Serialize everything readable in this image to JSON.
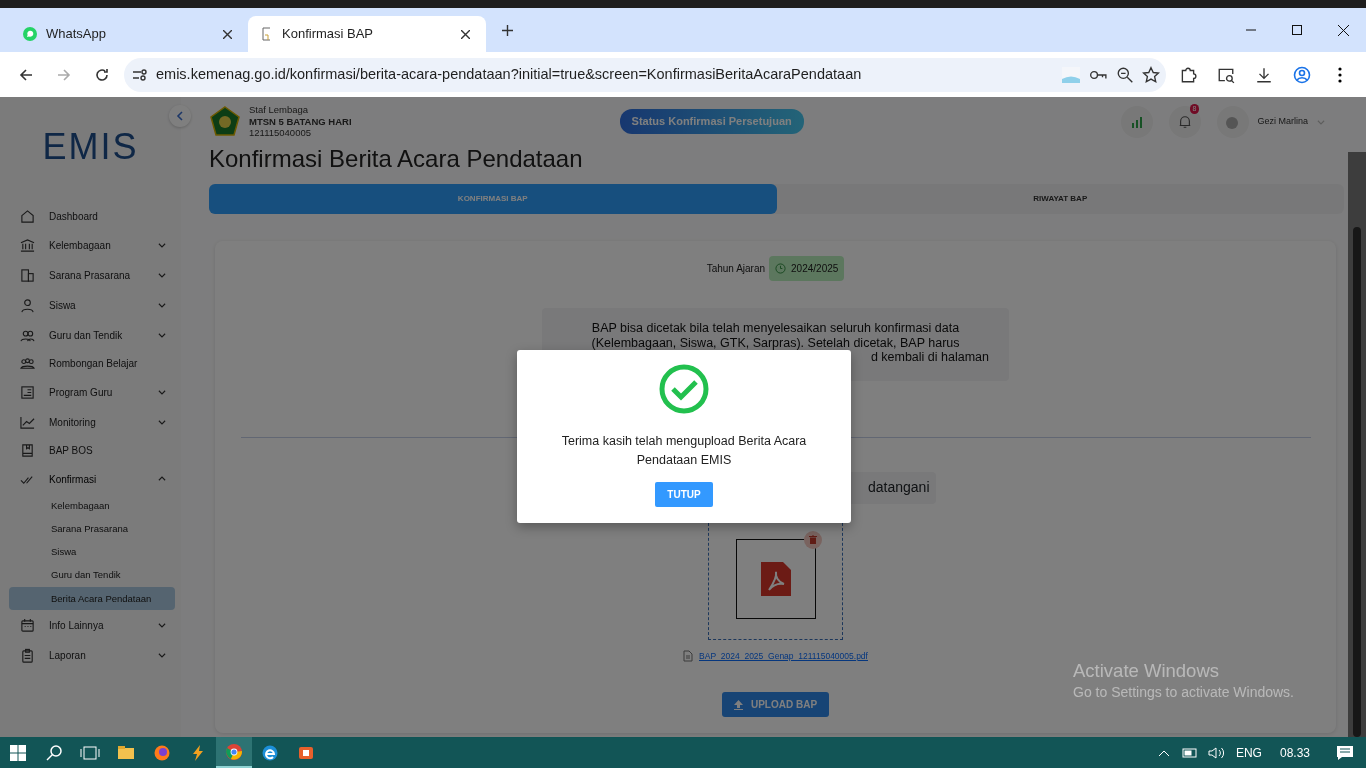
{
  "browser": {
    "tabs": [
      {
        "title": "WhatsApp",
        "kind": "whatsapp",
        "selected": false
      },
      {
        "title": "Konfirmasi BAP",
        "kind": "emis",
        "selected": true
      }
    ],
    "url": "emis.kemenag.go.id/konfirmasi/berita-acara-pendataan?initial=true&screen=KonfirmasiBeritaAcaraPendataan"
  },
  "sidebar": {
    "logo": "EMIS",
    "items": [
      {
        "label": "Dashboard",
        "expandable": false,
        "expanded": false,
        "selected": false
      },
      {
        "label": "Kelembagaan",
        "expandable": true,
        "expanded": false,
        "selected": false
      },
      {
        "label": "Sarana Prasarana",
        "expandable": true,
        "expanded": false,
        "selected": false
      },
      {
        "label": "Siswa",
        "expandable": true,
        "expanded": false,
        "selected": false
      },
      {
        "label": "Guru dan Tendik",
        "expandable": true,
        "expanded": false,
        "selected": false
      },
      {
        "label": "Rombongan Belajar",
        "expandable": false,
        "expanded": false,
        "selected": false
      },
      {
        "label": "Program Guru",
        "expandable": true,
        "expanded": false,
        "selected": false
      },
      {
        "label": "Monitoring",
        "expandable": true,
        "expanded": false,
        "selected": false
      },
      {
        "label": "BAP BOS",
        "expandable": false,
        "expanded": false,
        "selected": false
      },
      {
        "label": "Konfirmasi",
        "expandable": true,
        "expanded": true,
        "selected": false,
        "children": [
          {
            "label": "Kelembagaan",
            "selected": false
          },
          {
            "label": "Sarana Prasarana",
            "selected": false
          },
          {
            "label": "Siswa",
            "selected": false
          },
          {
            "label": "Guru dan Tendik",
            "selected": false
          },
          {
            "label": "Berita Acara Pendataan",
            "selected": true
          }
        ]
      },
      {
        "label": "Info Lainnya",
        "expandable": true,
        "expanded": false,
        "selected": false
      },
      {
        "label": "Laporan",
        "expandable": true,
        "expanded": false,
        "selected": false
      }
    ]
  },
  "header": {
    "role": "Staf Lembaga",
    "school": "MTSN 5 BATANG HARI",
    "npsn": "121115040005",
    "status_button": "Status Konfirmasi Persetujuan",
    "notification_count": "8",
    "user": "Gezi Marlina"
  },
  "page": {
    "title": "Konfirmasi Berita Acara Pendataan",
    "tabs": [
      {
        "label": "KONFIRMASI BAP",
        "selected": true
      },
      {
        "label": "RIWAYAT BAP",
        "selected": false
      }
    ],
    "year_label": "Tahun Ajaran",
    "year": "2024/2025",
    "info_lines": [
      "BAP bisa dicetak bila telah menyelesaikan seluruh konfirmasi data",
      "(Kelembagaan, Siswa, GTK, Sarpras). Setelah dicetak, BAP harus"
    ],
    "info_fragment": "d kembali di halaman",
    "instruction_fragment": "datangani",
    "file_name": "BAP_2024_2025_Genap_121115040005.pdf",
    "upload_button": "UPLOAD BAP"
  },
  "modal": {
    "message": "Terima kasih telah mengupload Berita Acara Pendataan EMIS",
    "button": "TUTUP"
  },
  "activation": {
    "title": "Activate Windows",
    "hint": "Go to Settings to activate Windows."
  },
  "taskbar": {
    "apps": [
      {
        "kind": "explorer",
        "selected": false
      },
      {
        "kind": "firefox",
        "selected": false
      },
      {
        "kind": "bolt",
        "selected": false
      },
      {
        "kind": "chrome",
        "selected": true
      },
      {
        "kind": "edge",
        "selected": false
      },
      {
        "kind": "office",
        "selected": false
      }
    ],
    "language": "ENG",
    "time": "08.33"
  }
}
